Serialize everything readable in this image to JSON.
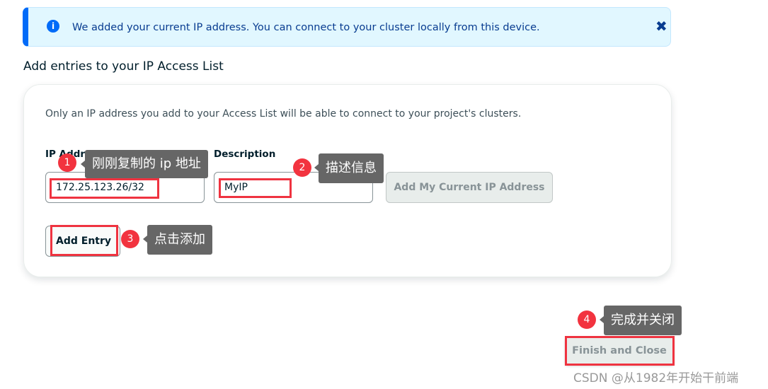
{
  "banner": {
    "icon": "info-icon",
    "text": "We added your current IP address. You can connect to your cluster locally from this device.",
    "close_icon": "close-icon"
  },
  "section_title": "Add entries to your IP Access List",
  "card": {
    "description": "Only an IP address you add to your Access List will be able to connect to your project's clusters.",
    "ip_label": "IP Address",
    "ip_value": "172.25.123.26/32",
    "desc_label": "Description",
    "desc_value": "MyIP",
    "add_current_ip": "Add My Current IP Address",
    "add_entry": "Add Entry"
  },
  "finish_button": "Finish and Close",
  "annotations": [
    {
      "number": "1",
      "text": "刚刚复制的 ip 地址"
    },
    {
      "number": "2",
      "text": "描述信息"
    },
    {
      "number": "3",
      "text": "点击添加"
    },
    {
      "number": "4",
      "text": "完成并关闭"
    }
  ],
  "watermark": "CSDN @从1982年开始干前端",
  "colors": {
    "accent": "#016bf8",
    "highlight": "#ef3340",
    "banner_bg": "#e1f7ff"
  }
}
